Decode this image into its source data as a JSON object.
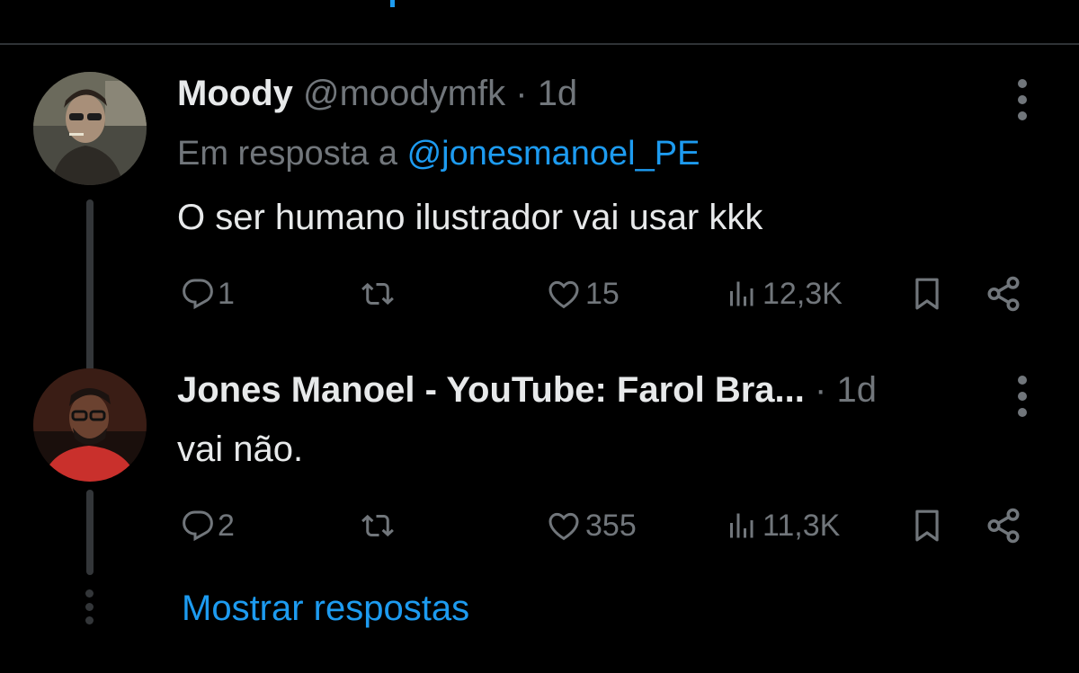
{
  "colors": {
    "background": "#000000",
    "text": "#e7e9ea",
    "muted": "#71767b",
    "accent": "#1d9bf0",
    "divider": "#2f3336"
  },
  "tweets": [
    {
      "name": "Moody",
      "handle": "@moodymfk",
      "separator": "·",
      "time": "1d",
      "reply_prefix": "Em resposta a",
      "reply_mention": "@jonesmanoel_PE",
      "text": "O ser humano ilustrador vai usar kkk",
      "replies": "1",
      "likes": "15",
      "views": "12,3K",
      "icons": [
        "reply-icon",
        "retweet-icon",
        "heart-icon",
        "views-icon",
        "bookmark-icon",
        "share-icon",
        "more-icon"
      ]
    },
    {
      "name": "Jones Manoel - YouTube: Farol Bra...",
      "separator": "·",
      "time": "1d",
      "text": "vai não.",
      "replies": "2",
      "likes": "355",
      "views": "11,3K",
      "icons": [
        "reply-icon",
        "retweet-icon",
        "heart-icon",
        "views-icon",
        "bookmark-icon",
        "share-icon",
        "more-icon"
      ]
    }
  ],
  "show_replies_label": "Mostrar respostas"
}
